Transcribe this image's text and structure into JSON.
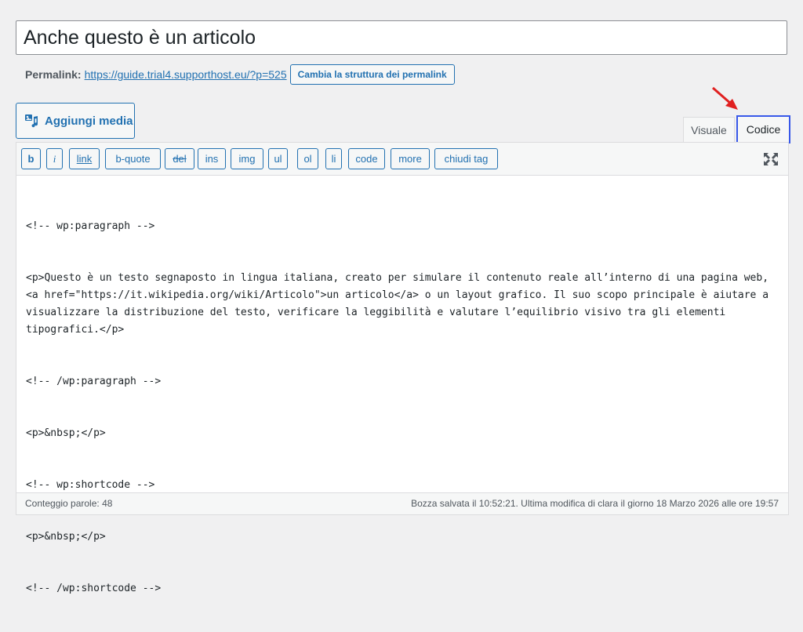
{
  "post": {
    "title": "Anche questo è un articolo"
  },
  "permalink": {
    "label": "Permalink:",
    "url": "https://guide.trial4.supporthost.eu/?p=525",
    "change_button": "Cambia la struttura dei permalink"
  },
  "media_button": {
    "label": "Aggiungi media",
    "icon": "media-icon"
  },
  "tabs": [
    {
      "label": "Visuale",
      "active": false
    },
    {
      "label": "Codice",
      "active": true
    }
  ],
  "toolbar": {
    "buttons": [
      "b",
      "i",
      "link",
      "b-quote",
      "del",
      "ins",
      "img",
      "ul",
      "ol",
      "li",
      "code",
      "more",
      "chiudi tag"
    ],
    "fullscreen_icon": "fullscreen-icon"
  },
  "content": {
    "lines": [
      "<!-- wp:paragraph -->",
      "<p>Questo è un testo segnaposto in lingua italiana, creato per simulare il contenuto reale all’interno di una pagina web, <a href=\"https://it.wikipedia.org/wiki/Articolo\">un articolo</a> o un layout grafico. Il suo scopo principale è aiutare a visualizzare la distribuzione del testo, verificare la leggibilità e valutare l’equilibrio visivo tra gli elementi tipografici.</p>",
      "<!-- /wp:paragraph -->",
      "<p>&nbsp;</p>",
      "<!-- wp:shortcode -->",
      "<p>&nbsp;</p>",
      "<!-- /wp:shortcode -->"
    ]
  },
  "status_bar": {
    "word_count": "Conteggio parole: 48",
    "saved": "Bozza salvata il 10:52:21. Ultima modifica di clara il giorno 18 Marzo 2026 alle ore 19:57"
  },
  "colors": {
    "accent": "#2271b1",
    "active_tab_border": "#3858e9",
    "arrow": "#e02020"
  }
}
